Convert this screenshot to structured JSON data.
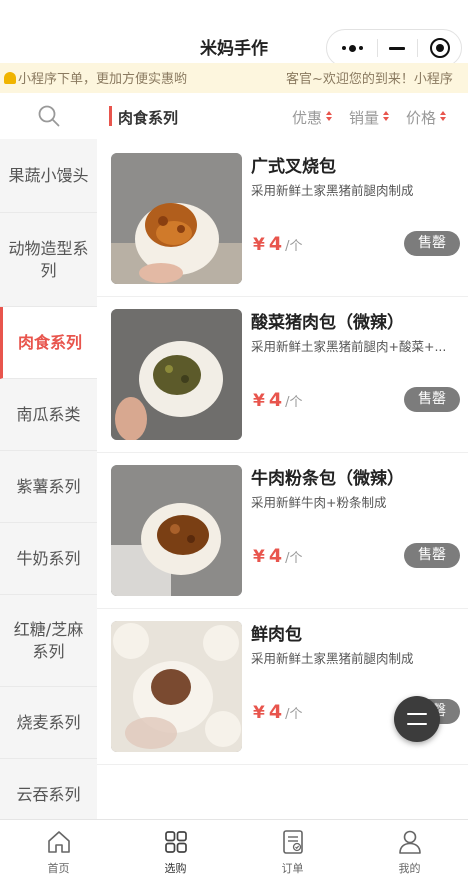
{
  "nav": {
    "title": "米妈手作"
  },
  "notice": {
    "part1": "小程序下单，更加方便实惠哟",
    "part2": "客官~欢迎您的到来！小程序"
  },
  "sidebar": {
    "search_icon": "search-icon",
    "categories": [
      "果蔬小馒头",
      "动物造型系列",
      "肉食系列",
      "南瓜系类",
      "紫薯系列",
      "牛奶系列",
      "红糖/芝麻系列",
      "烧麦系列",
      "云吞系列"
    ],
    "active_index": 2
  },
  "list_header": {
    "title": "肉食系列",
    "sort_discount": "优惠",
    "sort_sales": "销量",
    "sort_price": "价格"
  },
  "products": [
    {
      "name": "广式叉烧包",
      "desc": "采用新鲜土家黑猪前腿肉制成",
      "currency": "¥",
      "price": "4",
      "unit": "/个",
      "status": "售罄"
    },
    {
      "name": "酸菜猪肉包（微辣）",
      "desc": "采用新鲜土家黑猪前腿肉+酸菜+...",
      "currency": "¥",
      "price": "4",
      "unit": "/个",
      "status": "售罄"
    },
    {
      "name": "牛肉粉条包（微辣）",
      "desc": "采用新鲜牛肉+粉条制成",
      "currency": "¥",
      "price": "4",
      "unit": "/个",
      "status": "售罄"
    },
    {
      "name": "鲜肉包",
      "desc": "采用新鲜土家黑猪前腿肉制成",
      "currency": "¥",
      "price": "4",
      "unit": "/个",
      "status": "售罄"
    }
  ],
  "tabbar": [
    {
      "label": "首页",
      "icon": "home-icon"
    },
    {
      "label": "选购",
      "icon": "grid-icon"
    },
    {
      "label": "订单",
      "icon": "order-icon"
    },
    {
      "label": "我的",
      "icon": "user-icon"
    }
  ],
  "colors": {
    "accent": "#e8554d",
    "sold_out_bg": "#7c7c7c",
    "notice_bg": "#fdf6de"
  }
}
